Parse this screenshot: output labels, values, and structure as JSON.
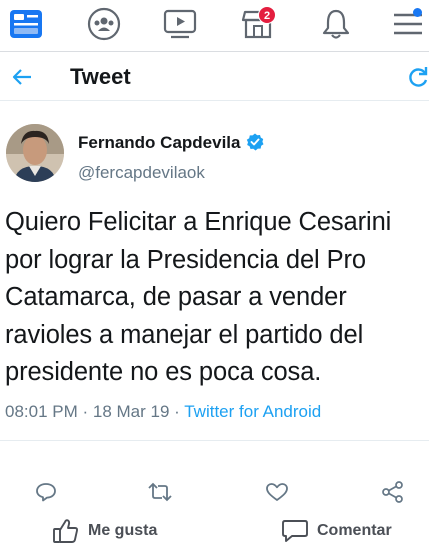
{
  "nav": {
    "icons": [
      "news-feed-icon",
      "groups-icon",
      "watch-icon",
      "marketplace-icon",
      "notifications-icon",
      "menu-icon"
    ],
    "marketplace_badge": "2",
    "accent": "#1877f2",
    "badge_color": "#e41e3f"
  },
  "header": {
    "title": "Tweet",
    "accent": "#1da1f2"
  },
  "tweet": {
    "author_name": "Fernando Capdevila",
    "handle": "@fercapdevilaok",
    "text": "Quiero Felicitar a Enrique Cesarini por lograr la Presidencia del Pro Catamarca, de pasar a vender ravioles a manejar el partido del presidente no es poca cosa.",
    "time": "08:01 PM",
    "date": "18 Mar 19",
    "source": "Twitter for Android",
    "separator": " · "
  },
  "actions": {
    "like_label": "Me gusta",
    "comment_label": "Comentar"
  }
}
